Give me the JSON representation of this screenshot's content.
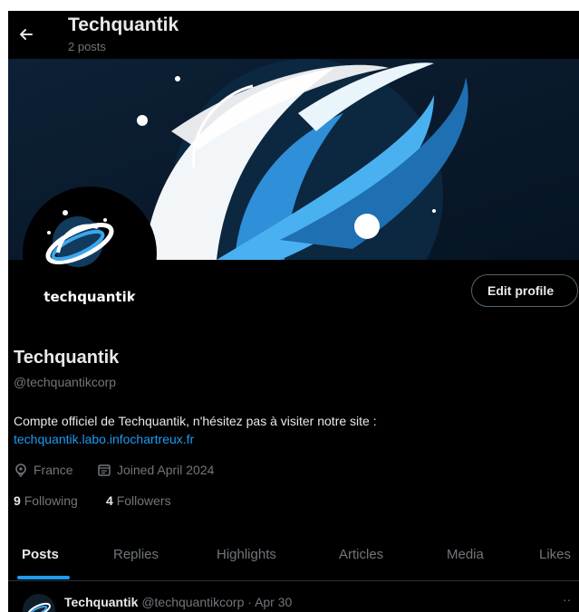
{
  "header": {
    "title": "Techquantik",
    "subtitle": "2 posts",
    "back_icon": "arrow-left-icon"
  },
  "avatar": {
    "text": "techquantik"
  },
  "actions": {
    "edit_profile": "Edit profile"
  },
  "profile": {
    "name": "Techquantik",
    "handle": "@techquantikcorp",
    "bio": "Compte officiel de Techquantik, n'hésitez pas à visiter notre site :",
    "link": "techquantik.labo.infochartreux.fr",
    "location": "France",
    "joined": "Joined April 2024",
    "following_count": "9",
    "following_label": "Following",
    "followers_count": "4",
    "followers_label": "Followers"
  },
  "tabs": [
    {
      "label": "Posts",
      "active": true
    },
    {
      "label": "Replies"
    },
    {
      "label": "Highlights"
    },
    {
      "label": "Articles"
    },
    {
      "label": "Media"
    },
    {
      "label": "Likes"
    }
  ],
  "post": {
    "author": "Techquantik",
    "handle": "@techquantikcorp",
    "separator": "·",
    "date": "Apr 30",
    "more": "··"
  },
  "colors": {
    "background": "#000000",
    "text": "#e7e9ea",
    "muted": "#71767b",
    "accent": "#1d9bf0",
    "border": "#536471"
  }
}
